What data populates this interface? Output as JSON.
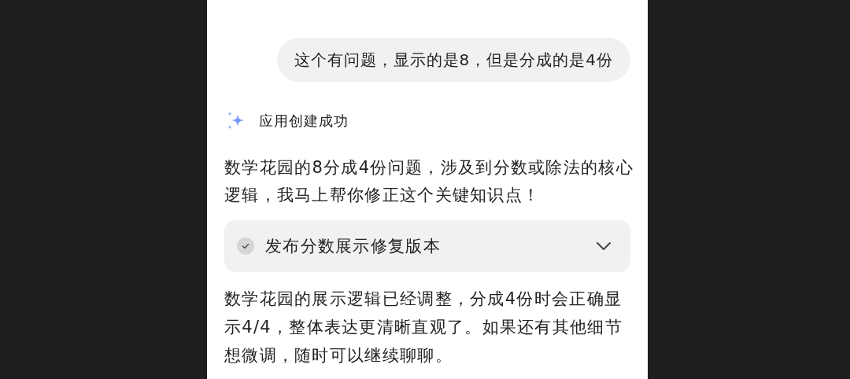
{
  "user_message": {
    "text": "这个有问题，显示的是8，但是分成的是4份"
  },
  "assistant": {
    "status_title": "应用创建成功",
    "intro": "数学花园的8分成4份问题，涉及到分数或除法的核心逻辑，我马上帮你修正这个关键知识点！",
    "step": {
      "label": "发布分数展示修复版本",
      "done": true,
      "expanded": false
    },
    "reply": "数学花园的展示逻辑已经调整，分成4份时会正确显示4/4，整体表达更清晰直观了。如果还有其他细节想微调，随时可以继续聊聊。"
  }
}
